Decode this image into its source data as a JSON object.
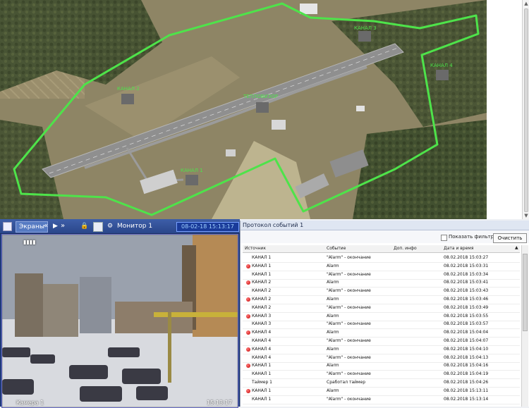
{
  "map": {
    "zones": [
      "КАНАЛ 1",
      "КАНАЛ 2",
      "КАНАЛ 3",
      "КАНАЛ 4",
      "ТЕПЛОВИЗОР"
    ],
    "zone_color": "#4ee34a"
  },
  "monitor": {
    "screens_label": "Экраны",
    "monitor_name": "Монитор 1",
    "datetime": "08-02-18 15:13:17",
    "camera_overlay": "Камера 1",
    "camera_time": "15:13:17"
  },
  "log": {
    "title": "Протокол событий 1",
    "show_filters_label": "Показать фильтры",
    "clear_label": "Очистить",
    "columns": [
      "Источник",
      "Событие",
      "Доп. инфо",
      "Дата и время"
    ],
    "rows": [
      {
        "alarm": false,
        "source": "КАНАЛ 1",
        "event": "\"Alarm\" - окончание",
        "info": "",
        "datetime": "08.02.2018 15:03:27"
      },
      {
        "alarm": true,
        "source": "КАНАЛ 1",
        "event": "Alarm",
        "info": "",
        "datetime": "08.02.2018 15:03:31"
      },
      {
        "alarm": false,
        "source": "КАНАЛ 1",
        "event": "\"Alarm\" - окончание",
        "info": "",
        "datetime": "08.02.2018 15:03:34"
      },
      {
        "alarm": true,
        "source": "КАНАЛ 2",
        "event": "Alarm",
        "info": "",
        "datetime": "08.02.2018 15:03:41"
      },
      {
        "alarm": false,
        "source": "КАНАЛ 2",
        "event": "\"Alarm\" - окончание",
        "info": "",
        "datetime": "08.02.2018 15:03:43"
      },
      {
        "alarm": true,
        "source": "КАНАЛ 2",
        "event": "Alarm",
        "info": "",
        "datetime": "08.02.2018 15:03:46"
      },
      {
        "alarm": false,
        "source": "КАНАЛ 2",
        "event": "\"Alarm\" - окончание",
        "info": "",
        "datetime": "08.02.2018 15:03:49"
      },
      {
        "alarm": true,
        "source": "КАНАЛ 3",
        "event": "Alarm",
        "info": "",
        "datetime": "08.02.2018 15:03:55"
      },
      {
        "alarm": false,
        "source": "КАНАЛ 3",
        "event": "\"Alarm\" - окончание",
        "info": "",
        "datetime": "08.02.2018 15:03:57"
      },
      {
        "alarm": true,
        "source": "КАНАЛ 4",
        "event": "Alarm",
        "info": "",
        "datetime": "08.02.2018 15:04:04"
      },
      {
        "alarm": false,
        "source": "КАНАЛ 4",
        "event": "\"Alarm\" - окончание",
        "info": "",
        "datetime": "08.02.2018 15:04:07"
      },
      {
        "alarm": true,
        "source": "КАНАЛ 4",
        "event": "Alarm",
        "info": "",
        "datetime": "08.02.2018 15:04:10"
      },
      {
        "alarm": false,
        "source": "КАНАЛ 4",
        "event": "\"Alarm\" - окончание",
        "info": "",
        "datetime": "08.02.2018 15:04:13"
      },
      {
        "alarm": true,
        "source": "КАНАЛ 1",
        "event": "Alarm",
        "info": "",
        "datetime": "08.02.2018 15:04:16"
      },
      {
        "alarm": false,
        "source": "КАНАЛ 1",
        "event": "\"Alarm\" - окончание",
        "info": "",
        "datetime": "08.02.2018 15:04:19"
      },
      {
        "alarm": false,
        "source": "Таймер 1",
        "event": "Сработал таймер",
        "info": "",
        "datetime": "08.02.2018 15:04:26"
      },
      {
        "alarm": true,
        "source": "КАНАЛ 1",
        "event": "Alarm",
        "info": "",
        "datetime": "08.02.2018 15:13:11"
      },
      {
        "alarm": false,
        "source": "КАНАЛ 1",
        "event": "\"Alarm\" - окончание",
        "info": "",
        "datetime": "08.02.2018 15:13:14"
      }
    ]
  }
}
